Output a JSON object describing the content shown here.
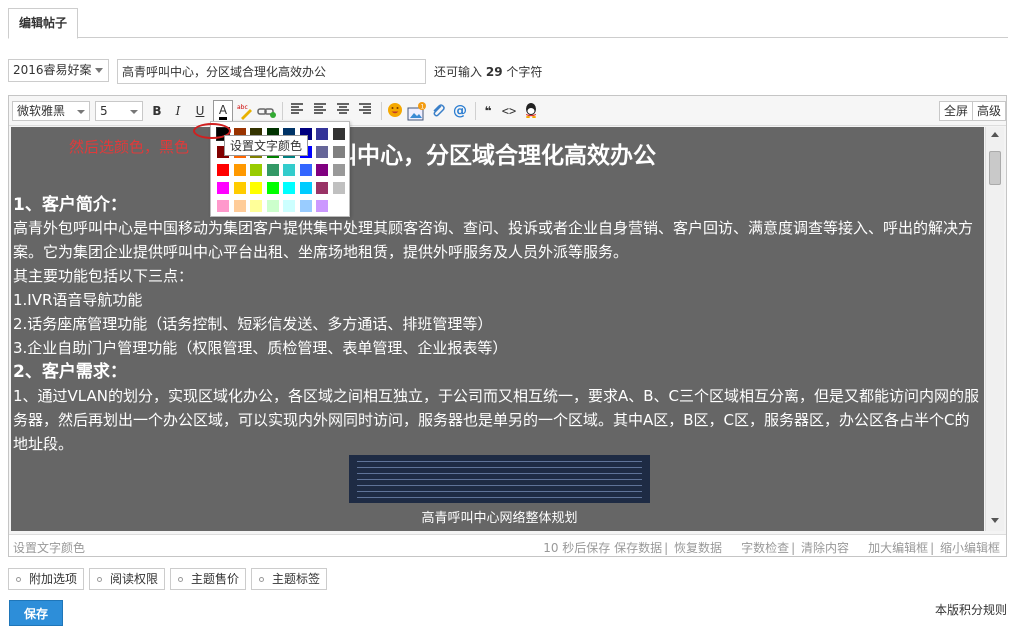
{
  "tab": {
    "label": "编辑帖子"
  },
  "category": {
    "selected": "2016睿易好案"
  },
  "title_input": {
    "value": "高青呼叫中心，分区域合理化高效办公"
  },
  "char_limit": {
    "prefix": "还可输入",
    "count": "29",
    "suffix": "个字符"
  },
  "toolbar": {
    "font_family": "微软雅黑",
    "font_size": "5",
    "bold": "B",
    "italic": "I",
    "underline": "U",
    "text_color": "A",
    "quote": "❝",
    "code": "<>",
    "fullscreen": "全屏",
    "advanced": "高级",
    "icons": [
      "font-color-icon",
      "highlight-icon",
      "link-icon",
      "align-left-icon",
      "align-left-2-icon",
      "align-center-icon",
      "align-right-icon",
      "emoji-icon",
      "image-icon",
      "attachment-icon",
      "mention-icon",
      "quote-icon",
      "code-icon",
      "qq-icon"
    ]
  },
  "editor": {
    "hint": "然后选颜色，黑色",
    "title_visible": "呼叫中心，分区域合理化高效办公",
    "paragraphs": [
      {
        "text": "1、客户简介：",
        "type": "heading"
      },
      {
        "text": "高青外包呼叫中心是中国移动为集团客户提供集中处理其顾客咨询、查问、投诉或者企业自身营销、客户回访、满意度调查等接入、呼出的解决方案。它为集团企业提供呼叫中心平台出租、坐席场地租赁，提供外呼服务及人员外派等服务。",
        "type": "body"
      },
      {
        "text": "其主要功能包括以下三点：",
        "type": "body"
      },
      {
        "text": "1.IVR语音导航功能",
        "type": "body"
      },
      {
        "text": "2.话务座席管理功能（话务控制、短彩信发送、多方通话、排班管理等）",
        "type": "body"
      },
      {
        "text": "3.企业自助门户管理功能（权限管理、质检管理、表单管理、企业报表等）",
        "type": "body"
      },
      {
        "text": "2、客户需求：",
        "type": "heading"
      },
      {
        "text": "1、通过VLAN的划分，实现区域化办公，各区域之间相互独立，于公司而又相互统一，要求A、B、C三个区域相互分离，但是又都能访问内网的服务器，然后再划出一个办公区域，可以实现内外网同时访问，服务器也是单另的一个区域。其中A区，B区，C区，服务器区，办公区各占半个C的地址段。",
        "type": "body"
      }
    ],
    "figure_caption": "高青呼叫中心网络整体规划",
    "background": "#666666"
  },
  "color_picker": {
    "tooltip": "设置文字颜色",
    "rows": [
      [
        "#000000",
        "#993300",
        "#333300",
        "#003300",
        "#003366",
        "#000080",
        "#333399",
        "#333333"
      ],
      [
        "#800000",
        "#FF6600",
        "#808000",
        "#008000",
        "#008080",
        "#0000FF",
        "#666699",
        "#808080"
      ],
      [
        "#FF0000",
        "#FF9900",
        "#99CC00",
        "#339966",
        "#33CCCC",
        "#3366FF",
        "#800080",
        "#999999"
      ],
      [
        "#FF00FF",
        "#FFCC00",
        "#FFFF00",
        "#00FF00",
        "#00FFFF",
        "#00CCFF",
        "#993366",
        "#C0C0C0"
      ],
      [
        "#FF99CC",
        "#FFCC99",
        "#FFFF99",
        "#CCFFCC",
        "#CCFFFF",
        "#99CCFF",
        "#CC99FF",
        "#FFFFFF"
      ]
    ]
  },
  "statusbar": {
    "left": "设置文字颜色",
    "autosave": "10 秒后保存",
    "save_data": "保存数据",
    "restore_data": "恢复数据",
    "word_check": "字数检查",
    "clear": "清除内容",
    "enlarge": "加大编辑框",
    "shrink": "缩小编辑框"
  },
  "options": {
    "addon": "附加选项",
    "read_perm": "阅读权限",
    "price": "主题售价",
    "tags": "主题标签"
  },
  "save_button": "保存",
  "credit_rules": "本版积分规则"
}
